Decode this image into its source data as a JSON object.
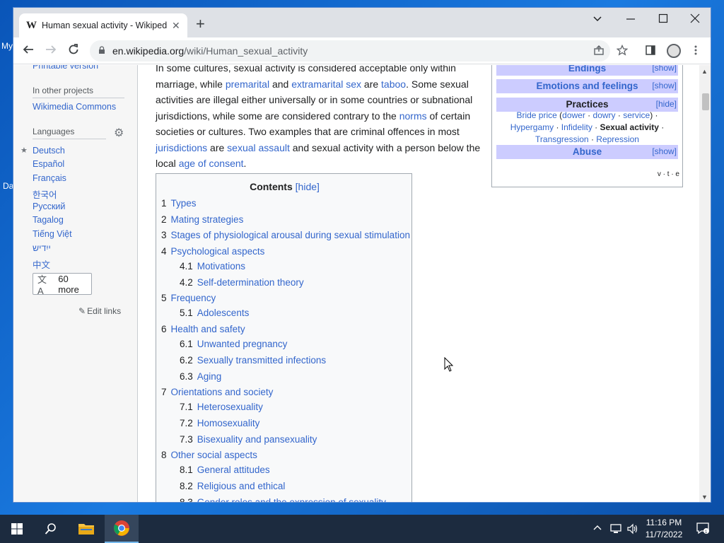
{
  "browser": {
    "tab_title": "Human sexual activity - Wikipedia",
    "tab_logo": "W",
    "new_tab": "+",
    "url_domain": "en.wikipedia.org",
    "url_path": "/wiki/Human_sexual_activity"
  },
  "desktop": {
    "icon1": "My",
    "icon2": "Da"
  },
  "sidebar": {
    "printable": "Printable version",
    "other_projects_head": "In other projects",
    "commons": "Wikimedia Commons",
    "languages_head": "Languages",
    "languages": [
      "Deutsch",
      "Español",
      "Français",
      "한국어",
      "Русский",
      "Tagalog",
      "Tiếng Việt",
      "ייִדיש",
      "中文"
    ],
    "more": "60 more",
    "edit_links": "Edit links"
  },
  "article": {
    "p1": "In some cultures, sexual activity is considered acceptable only within marriage, while",
    "l1": "premarital",
    "p2": "and",
    "l2": "extramarital sex",
    "p3": "are",
    "l3": "taboo",
    "p4": ". Some sexual activities are illegal either universally or in some countries or subnational jurisdictions, while some are considered contrary to the",
    "l4": "norms",
    "p5": "of certain societies or cultures. Two examples that are criminal offences in most",
    "l5": "jurisdictions",
    "p6": "are",
    "l6": "sexual assault",
    "p7": "and sexual activity with a person below the local",
    "l7": "age of consent",
    "p8": "."
  },
  "toc": {
    "title": "Contents",
    "hide": "[hide]",
    "items": [
      {
        "num": "1",
        "text": "Types"
      },
      {
        "num": "2",
        "text": "Mating strategies"
      },
      {
        "num": "3",
        "text": "Stages of physiological arousal during sexual stimulation"
      },
      {
        "num": "4",
        "text": "Psychological aspects"
      },
      {
        "num": "4.1",
        "text": "Motivations"
      },
      {
        "num": "4.2",
        "text": "Self-determination theory"
      },
      {
        "num": "5",
        "text": "Frequency"
      },
      {
        "num": "5.1",
        "text": "Adolescents"
      },
      {
        "num": "6",
        "text": "Health and safety"
      },
      {
        "num": "6.1",
        "text": "Unwanted pregnancy"
      },
      {
        "num": "6.2",
        "text": "Sexually transmitted infections"
      },
      {
        "num": "6.3",
        "text": "Aging"
      },
      {
        "num": "7",
        "text": "Orientations and society"
      },
      {
        "num": "7.1",
        "text": "Heterosexuality"
      },
      {
        "num": "7.2",
        "text": "Homosexuality"
      },
      {
        "num": "7.3",
        "text": "Bisexuality and pansexuality"
      },
      {
        "num": "8",
        "text": "Other social aspects"
      },
      {
        "num": "8.1",
        "text": "General attitudes"
      },
      {
        "num": "8.2",
        "text": "Religious and ethical"
      },
      {
        "num": "8.3",
        "text": "Gender roles and the expression of sexuality"
      }
    ]
  },
  "navbox": {
    "endings": "Endings",
    "emotions": "Emotions and feelings",
    "practices": "Practices",
    "abuse": "Abuse",
    "show": "[show]",
    "hide": "[hide]",
    "practices_links": {
      "bride_price": "Bride price",
      "dower": "dower",
      "dowry": "dowry",
      "service": "service",
      "hypergamy": "Hypergamy",
      "infidelity": "Infidelity",
      "sexual_activity": "Sexual activity",
      "transgression": "Transgression",
      "repression": "Repression"
    },
    "vte": "v · t · e"
  },
  "taskbar": {
    "time": "11:16 PM",
    "date": "11/7/2022"
  },
  "colors": {
    "link": "#3366cc",
    "navbox_header": "#ccccff",
    "taskbar": "#1c2b3f"
  }
}
